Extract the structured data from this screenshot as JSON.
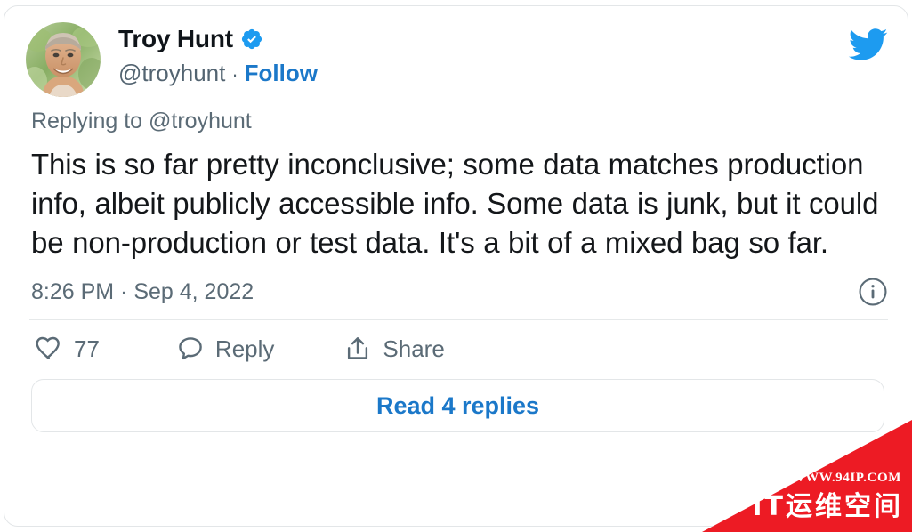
{
  "card": {
    "accent_blue": "#1b78c9",
    "verified_blue": "#1d9bf0",
    "text_color": "#14171a",
    "muted_color": "#5b6b76",
    "border_color": "#e3e6e8"
  },
  "header": {
    "display_name": "Troy Hunt",
    "verified_badge_name": "verified-badge-icon",
    "handle": "@troyhunt",
    "separator": "·",
    "follow_label": "Follow",
    "brand_icon": "twitter-bird-icon",
    "avatar_alt": "troy-hunt-avatar"
  },
  "reply_context": {
    "prefix": "Replying to",
    "mention": "@troyhunt"
  },
  "tweet": {
    "text": "This is so far pretty inconclusive; some data matches production info, albeit publicly accessible info. Some data is junk, but it could be non-production or test data. It's a bit of a mixed bag so far."
  },
  "meta": {
    "time": "8:26 PM",
    "separator": "·",
    "date": "Sep 4, 2022",
    "timestamp_full": "8:26 PM · Sep 4, 2022",
    "info_icon": "info-circle-icon"
  },
  "actions": {
    "like": {
      "icon": "heart-icon",
      "count": "77"
    },
    "reply": {
      "icon": "comment-icon",
      "label": "Reply"
    },
    "share": {
      "icon": "share-icon",
      "label": "Share"
    }
  },
  "footer": {
    "read_replies_label": "Read 4 replies"
  },
  "watermark": {
    "url": "WWW.94IP.COM",
    "title": "IT运维空间",
    "color": "#ed1b24"
  }
}
